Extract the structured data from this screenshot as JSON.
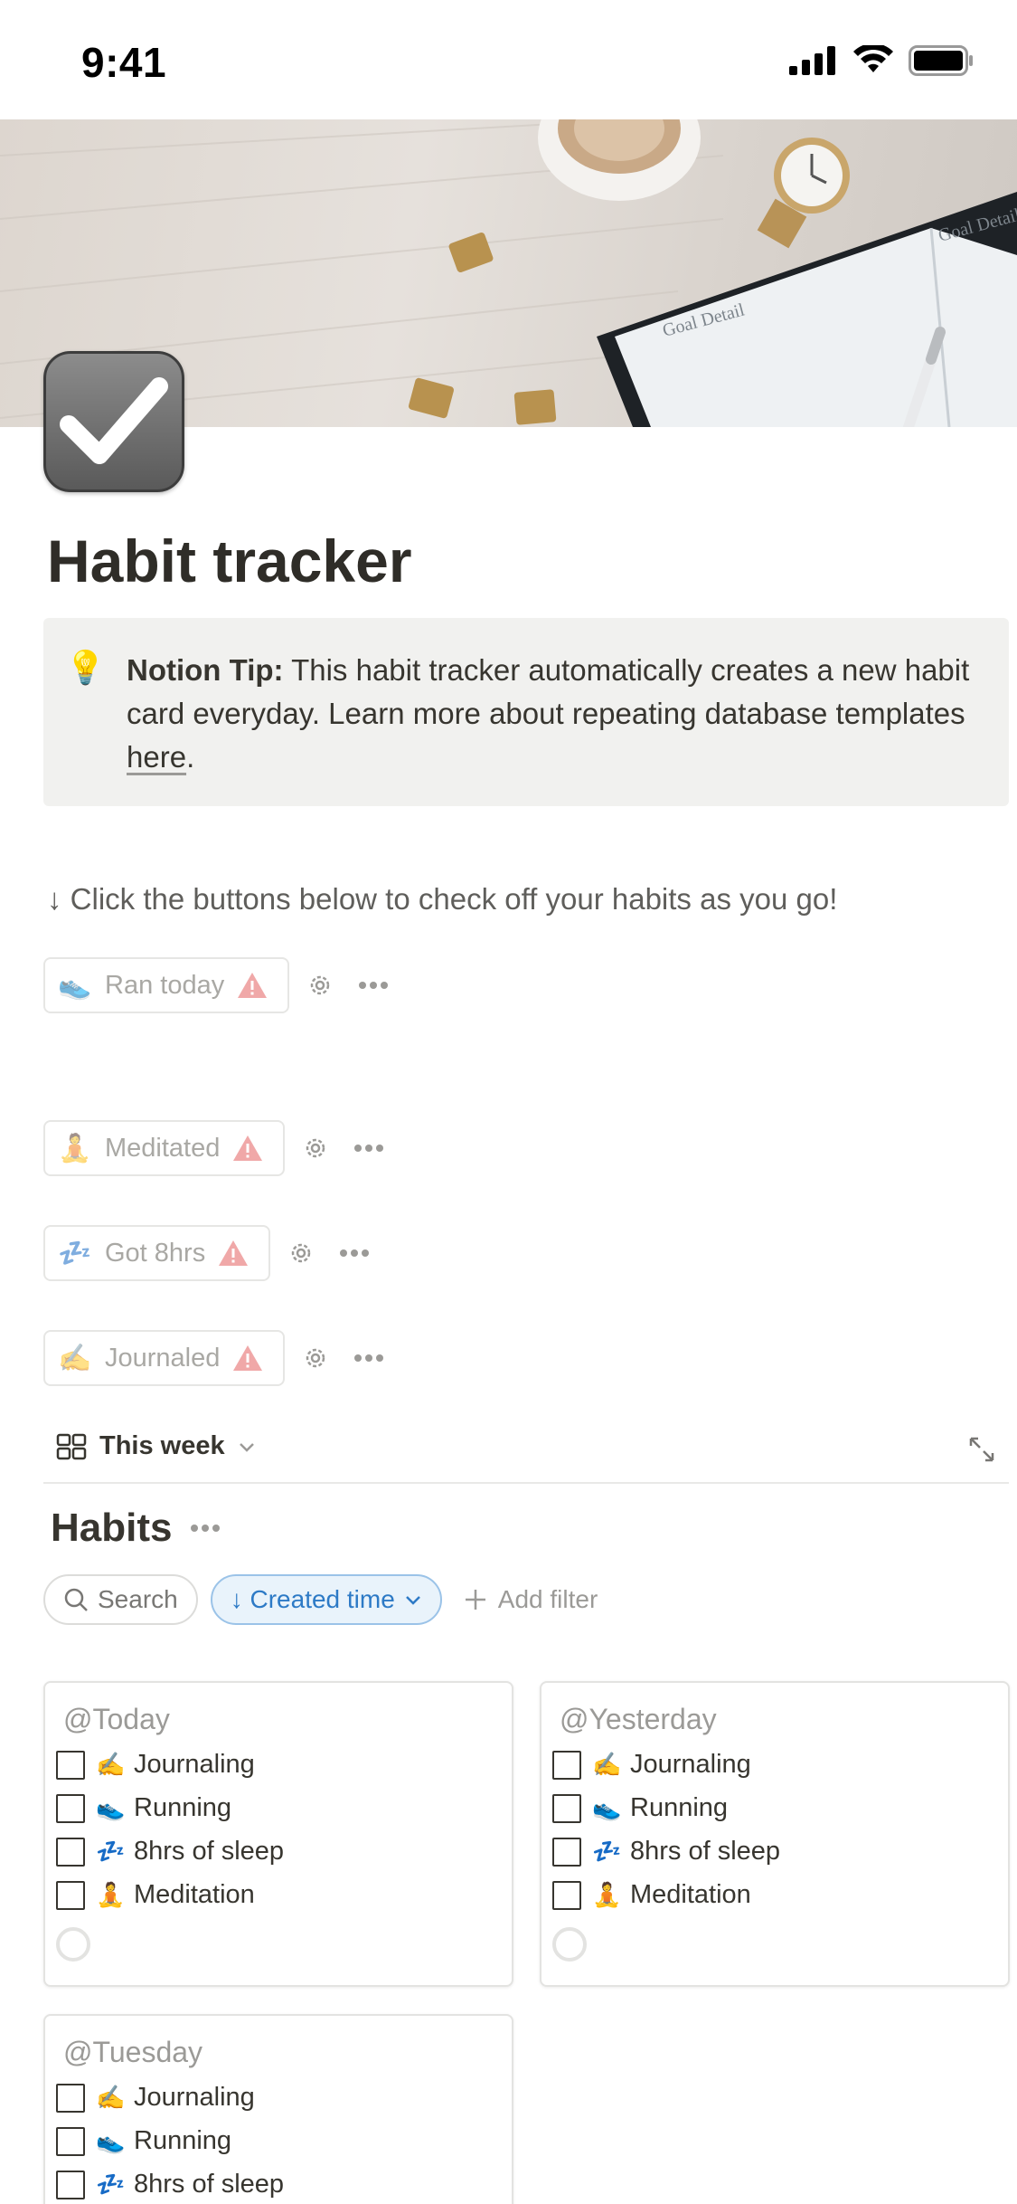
{
  "status_bar": {
    "time": "9:41"
  },
  "page": {
    "title": "Habit tracker",
    "icon": "checkbox-icon"
  },
  "callout": {
    "icon": "💡",
    "bold": "Notion Tip:",
    "text": " This habit tracker automatically creates a new habit card everyday. Learn more about repeating database templates ",
    "link": "here",
    "suffix": "."
  },
  "instructions": "↓ Click the buttons below to check off your habits as you go!",
  "habit_buttons": [
    {
      "emoji": "👟",
      "label": "Ran today"
    },
    {
      "emoji": "🧘",
      "label": "Meditated"
    },
    {
      "emoji": "💤",
      "label": "Got 8hrs"
    },
    {
      "emoji": "✍️",
      "label": "Journaled"
    }
  ],
  "view": {
    "tab_label": "This week"
  },
  "database": {
    "title": "Habits",
    "search_label": "Search",
    "sort_label": "↓ Created time",
    "add_filter_label": "Add filter",
    "cards": [
      {
        "title": "@Today",
        "items": [
          {
            "emoji": "✍️",
            "label": "Journaling"
          },
          {
            "emoji": "👟",
            "label": "Running"
          },
          {
            "emoji": "💤",
            "label": "8hrs of sleep"
          },
          {
            "emoji": "🧘",
            "label": "Meditation"
          }
        ]
      },
      {
        "title": "@Yesterday",
        "items": [
          {
            "emoji": "✍️",
            "label": "Journaling"
          },
          {
            "emoji": "👟",
            "label": "Running"
          },
          {
            "emoji": "💤",
            "label": "8hrs of sleep"
          },
          {
            "emoji": "🧘",
            "label": "Meditation"
          }
        ]
      },
      {
        "title": "@Tuesday",
        "items": [
          {
            "emoji": "✍️",
            "label": "Journaling"
          },
          {
            "emoji": "👟",
            "label": "Running"
          },
          {
            "emoji": "💤",
            "label": "8hrs of sleep"
          }
        ]
      }
    ]
  },
  "colors": {
    "text": "#37352f",
    "muted": "#9b9a97",
    "warning": "#eb5757",
    "accent_blue": "#2d7ac6",
    "callout_bg": "#f1f1ef"
  }
}
